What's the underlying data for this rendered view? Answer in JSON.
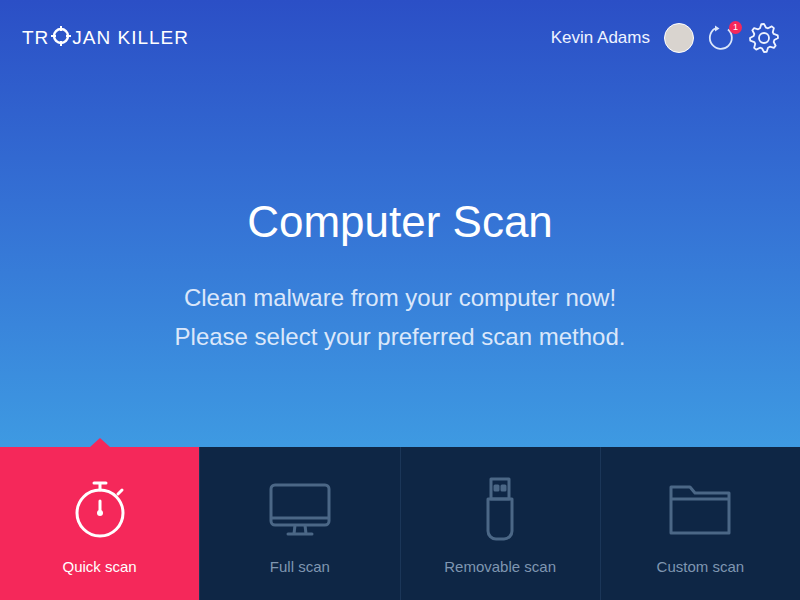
{
  "header": {
    "logo": {
      "before": "TR",
      "after": "JAN KILLER"
    },
    "user": {
      "name": "Kevin Adams"
    },
    "updates_badge": "1"
  },
  "hero": {
    "title": "Computer Scan",
    "subtitle": [
      "Clean malware from your computer now!",
      "Please select your preferred scan method."
    ]
  },
  "scan_methods": [
    {
      "label": "Quick scan",
      "selected": true,
      "kind": "stopwatch"
    },
    {
      "label": "Full scan",
      "selected": false,
      "kind": "monitor"
    },
    {
      "label": "Removable scan",
      "selected": false,
      "kind": "usb"
    },
    {
      "label": "Custom scan",
      "selected": false,
      "kind": "folder"
    }
  ]
}
